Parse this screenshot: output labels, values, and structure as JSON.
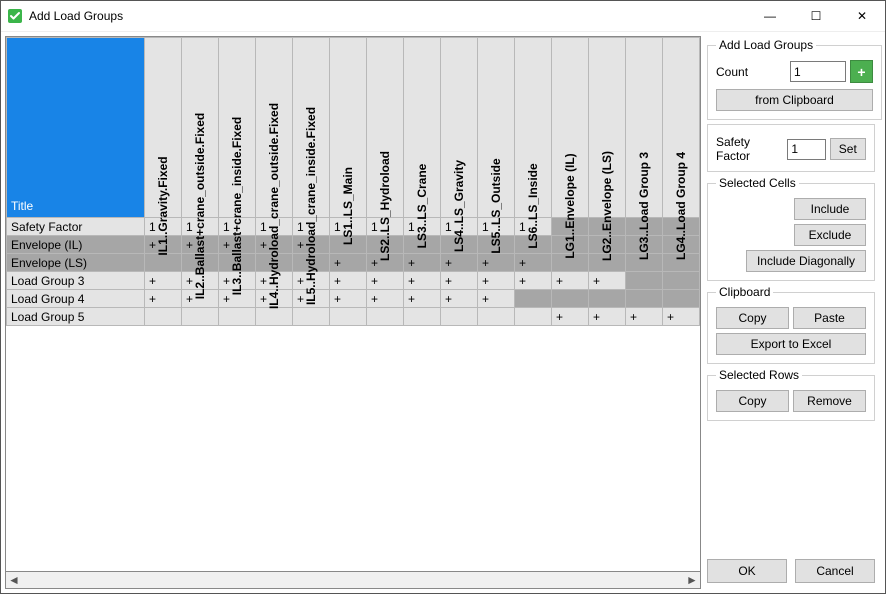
{
  "window": {
    "title": "Add Load Groups"
  },
  "sysbuttons": {
    "min": "—",
    "max": "☐",
    "close": "✕"
  },
  "grid": {
    "corner": "Title",
    "columns": [
      "IL1..Gravity.Fixed",
      "IL2..Ballast+crane_outside.Fixed",
      "IL3..Ballast+crane_inside.Fixed",
      "IL4..Hydroload_crane_outside.Fixed",
      "IL5..Hydroload_crane_inside.Fixed",
      "LS1..LS_Main",
      "LS2..LS_Hydroload",
      "LS3..LS_Crane",
      "LS4..LS_Gravity",
      "LS5..LS_Outside",
      "LS6..LS_Inside",
      "LG1..Envelope (IL)",
      "LG2..Envelope (LS)",
      "LG3..Load Group 3",
      "LG4..Load Group 4"
    ],
    "rows": [
      {
        "name": "Safety Factor",
        "dark": false,
        "cells": [
          "1",
          "1",
          "1",
          "1",
          "1",
          "1",
          "1",
          "1",
          "1",
          "1",
          "1",
          "",
          "",
          "",
          ""
        ]
      },
      {
        "name": "Envelope (IL)",
        "dark": true,
        "cells": [
          "+",
          "+",
          "+",
          "+",
          "+",
          "",
          "",
          "",
          "",
          "",
          "",
          "",
          "",
          "",
          ""
        ]
      },
      {
        "name": "Envelope (LS)",
        "dark": true,
        "cells": [
          "",
          "",
          "",
          "",
          "",
          "+",
          "+",
          "+",
          "+",
          "+",
          "+",
          "",
          "",
          "",
          ""
        ]
      },
      {
        "name": "Load Group 3",
        "dark": false,
        "cells": [
          "+",
          "+",
          "+",
          "+",
          "+",
          "+",
          "+",
          "+",
          "+",
          "+",
          "+",
          "+",
          "+",
          "",
          ""
        ]
      },
      {
        "name": "Load Group 4",
        "dark": false,
        "cells": [
          "+",
          "+",
          "+",
          "+",
          "+",
          "+",
          "+",
          "+",
          "+",
          "+",
          "",
          "",
          "",
          "",
          ""
        ]
      },
      {
        "name": "Load Group 5",
        "dark": false,
        "cells": [
          "",
          "",
          "",
          "",
          "",
          "",
          "",
          "",
          "",
          "",
          "",
          "+",
          "+",
          "+",
          "+"
        ]
      }
    ]
  },
  "panel": {
    "addGroup": {
      "legend": "Add Load Groups",
      "countLabel": "Count",
      "countValue": "1",
      "plus": "+",
      "fromClipboard": "from Clipboard"
    },
    "safety": {
      "label": "Safety Factor",
      "value": "1",
      "set": "Set"
    },
    "selectedCells": {
      "legend": "Selected Cells",
      "include": "Include",
      "exclude": "Exclude",
      "diag": "Include Diagonally"
    },
    "clipboard": {
      "legend": "Clipboard",
      "copy": "Copy",
      "paste": "Paste",
      "export": "Export to Excel"
    },
    "selectedRows": {
      "legend": "Selected Rows",
      "copy": "Copy",
      "remove": "Remove"
    },
    "ok": "OK",
    "cancel": "Cancel"
  }
}
